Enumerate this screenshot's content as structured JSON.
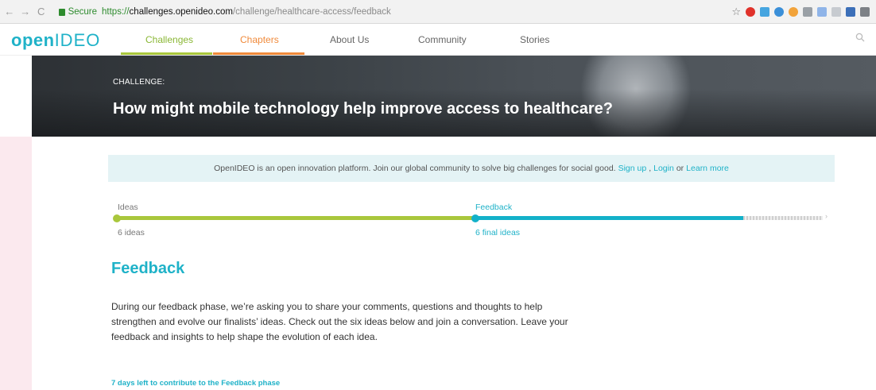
{
  "browser": {
    "secure_label": "Secure",
    "url_scheme": "https://",
    "url_host": "challenges.openideo.com",
    "url_path": "/challenge/healthcare-access/feedback"
  },
  "header": {
    "logo_main": "open",
    "logo_light": "IDEO",
    "nav": [
      {
        "label": "Challenges",
        "color": "#8ab735"
      },
      {
        "label": "Chapters",
        "color": "#f08a3b"
      },
      {
        "label": "About Us",
        "color": "#666666"
      },
      {
        "label": "Community",
        "color": "#666666"
      },
      {
        "label": "Stories",
        "color": "#666666"
      }
    ]
  },
  "hero": {
    "label": "CHALLENGE:",
    "title": "How might mobile technology help improve access to healthcare?"
  },
  "banner": {
    "text": "OpenIDEO is an open innovation platform. Join our global community to solve big challenges for social good.",
    "signup": "Sign up",
    "comma": ",",
    "login": "Login",
    "or": "or",
    "learn_more": "Learn more"
  },
  "phases": {
    "ideas": {
      "label": "Ideas",
      "count": "6 ideas"
    },
    "feedback": {
      "label": "Feedback",
      "count": "6 final ideas"
    }
  },
  "content": {
    "title": "Feedback",
    "description": "During our feedback phase, we’re asking you to share your comments, questions and thoughts to help strengthen and evolve our finalists’ ideas. Check out the six ideas below and join a conversation. Leave your feedback and insights to help shape the evolution of each idea.",
    "days_left": "7 days left to contribute to the Feedback phase"
  },
  "colors": {
    "brand_teal": "#1fb2c8",
    "ideas_green": "#a9c73c",
    "chapters_orange": "#f08a3b"
  }
}
